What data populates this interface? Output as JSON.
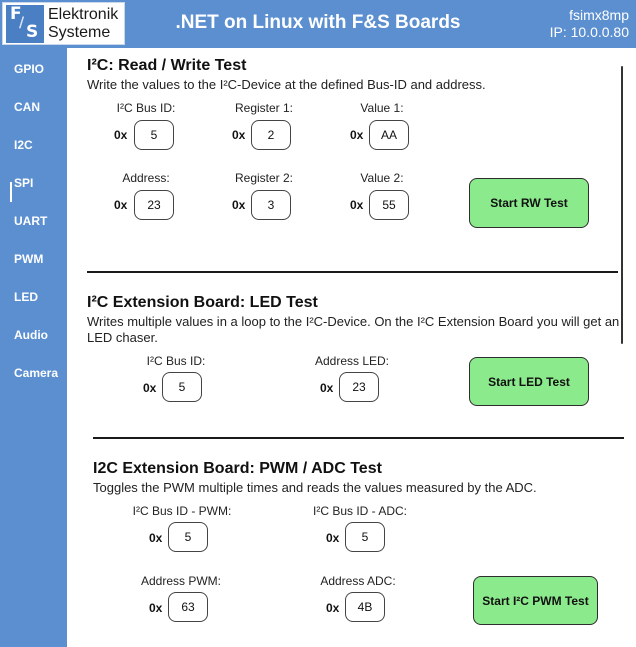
{
  "header": {
    "logo_line1": "Elektronik",
    "logo_line2": "Systeme",
    "logo_mark": "F&S",
    "title": ".NET on Linux with F&S Boards",
    "device_name": "fsimx8mp",
    "ip": "IP: 10.0.0.80"
  },
  "sidebar": {
    "active": "I2C",
    "items": [
      {
        "label": "GPIO"
      },
      {
        "label": "CAN"
      },
      {
        "label": "I2C"
      },
      {
        "label": "SPI"
      },
      {
        "label": "UART"
      },
      {
        "label": "PWM"
      },
      {
        "label": "LED"
      },
      {
        "label": "Audio"
      },
      {
        "label": "Camera"
      }
    ]
  },
  "rw_test": {
    "title": "I²C: Read / Write Test",
    "description": "Write the values to the I²C-Device at the defined Bus-ID and address.",
    "prefix": "0x",
    "bus_id_label": "I²C Bus ID:",
    "bus_id": "5",
    "register1_label": "Register 1:",
    "register1": "2",
    "value1_label": "Value 1:",
    "value1": "AA",
    "address_label": "Address:",
    "address": "23",
    "register2_label": "Register 2:",
    "register2": "3",
    "value2_label": "Value 2:",
    "value2": "55",
    "button": "Start RW Test"
  },
  "led_test": {
    "title": "I²C Extension Board: LED Test",
    "description": "Writes multiple values in a loop to the I²C-Device. On the I²C Extension Board you will get an LED chaser.",
    "prefix": "0x",
    "bus_id_label": "I²C Bus ID:",
    "bus_id": "5",
    "address_label": "Address LED:",
    "address": "23",
    "button": "Start LED Test"
  },
  "pwm_test": {
    "title": "I2C Extension Board: PWM / ADC Test",
    "description": "Toggles the PWM multiple times and reads the values measured by the ADC.",
    "prefix": "0x",
    "bus_pwm_label": "I²C Bus ID - PWM:",
    "bus_pwm": "5",
    "bus_adc_label": "I²C Bus ID - ADC:",
    "bus_adc": "5",
    "addr_pwm_label": "Address PWM:",
    "addr_pwm": "63",
    "addr_adc_label": "Address ADC:",
    "addr_adc": "4B",
    "button": "Start I²C PWM Test"
  },
  "colors": {
    "accent": "#5b8fd0",
    "button_green": "#8bea8b"
  }
}
